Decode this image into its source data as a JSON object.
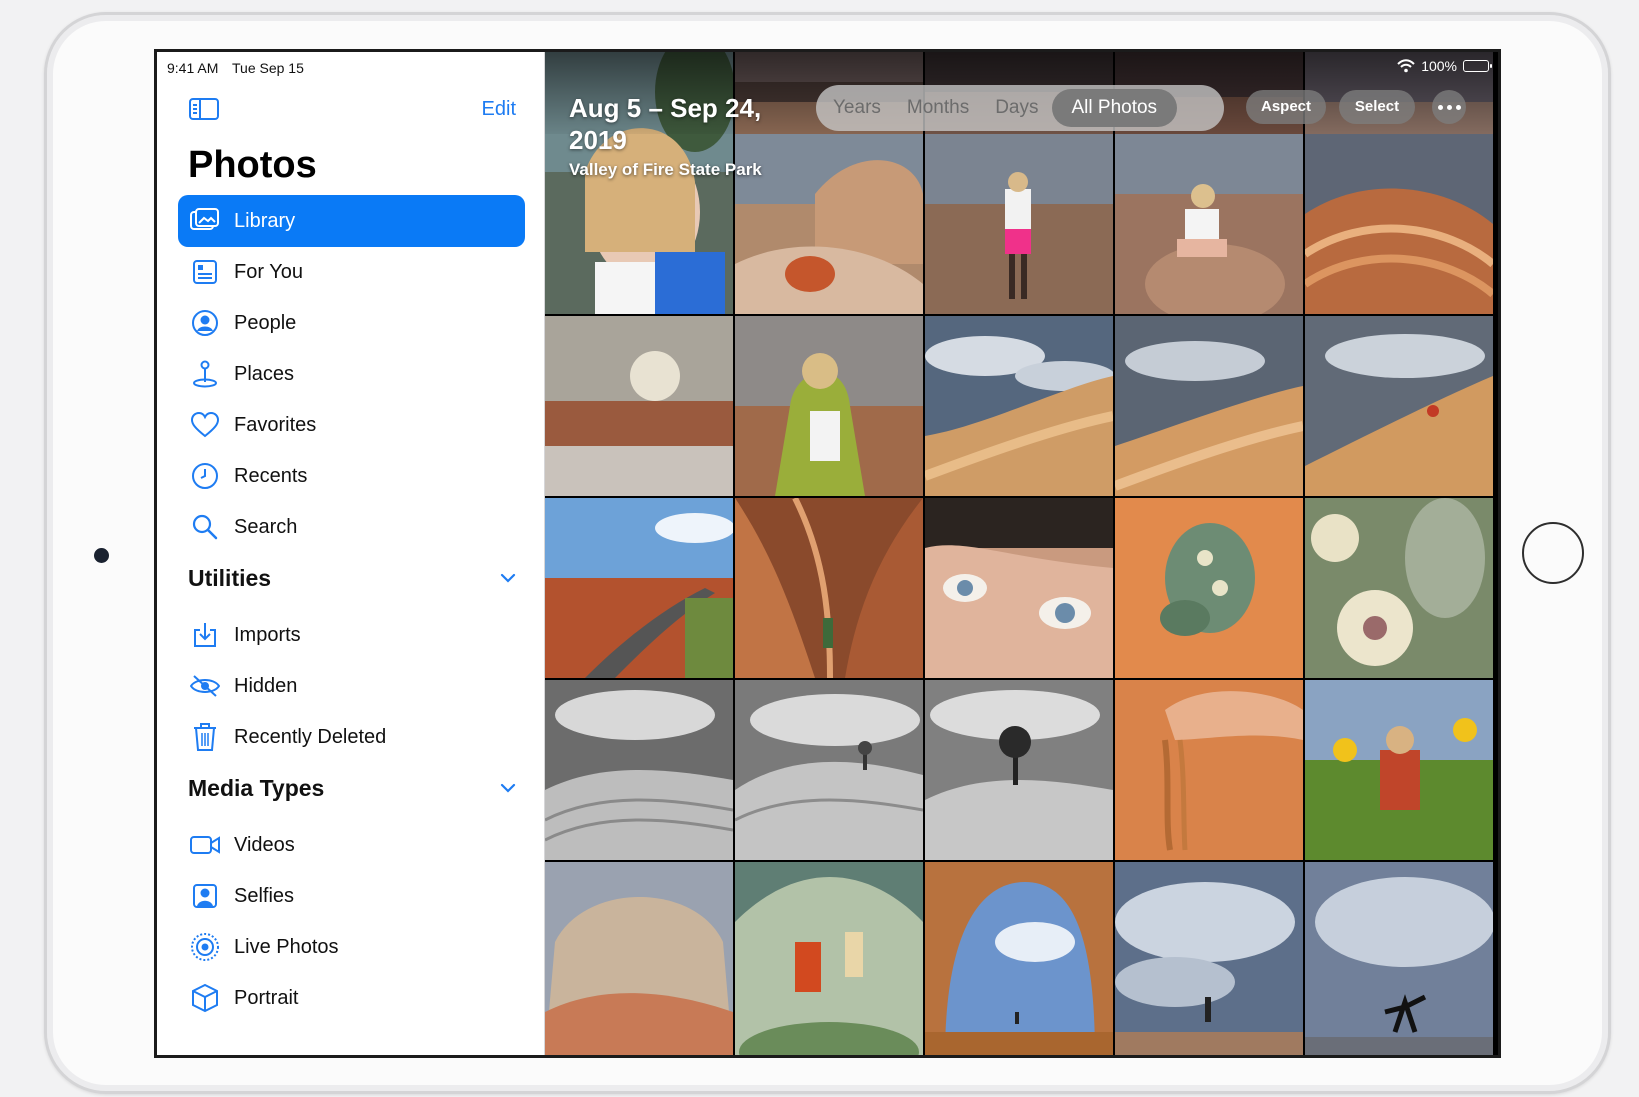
{
  "status_bar": {
    "time": "9:41 AM",
    "date": "Tue Sep 15",
    "battery": "100%"
  },
  "sidebar": {
    "edit_label": "Edit",
    "title": "Photos",
    "items": [
      {
        "label": "Library",
        "icon": "library-icon"
      },
      {
        "label": "For You",
        "icon": "for-you-icon"
      },
      {
        "label": "People",
        "icon": "people-icon"
      },
      {
        "label": "Places",
        "icon": "places-icon"
      },
      {
        "label": "Favorites",
        "icon": "heart-icon"
      },
      {
        "label": "Recents",
        "icon": "clock-icon"
      },
      {
        "label": "Search",
        "icon": "search-icon"
      }
    ],
    "utilities": {
      "title": "Utilities",
      "items": [
        {
          "label": "Imports",
          "icon": "import-icon"
        },
        {
          "label": "Hidden",
          "icon": "hidden-eye-icon"
        },
        {
          "label": "Recently Deleted",
          "icon": "trash-icon"
        }
      ]
    },
    "media_types": {
      "title": "Media Types",
      "items": [
        {
          "label": "Videos",
          "icon": "video-camera-icon"
        },
        {
          "label": "Selfies",
          "icon": "selfie-icon"
        },
        {
          "label": "Live Photos",
          "icon": "live-photo-icon"
        },
        {
          "label": "Portrait",
          "icon": "cube-icon"
        }
      ]
    }
  },
  "library": {
    "date_range": "Aug 5 – Sep 24, 2019",
    "location": "Valley of Fire State Park",
    "segments": [
      "Years",
      "Months",
      "Days",
      "All Photos"
    ],
    "active_segment": "All Photos",
    "aspect_label": "Aspect",
    "select_label": "Select"
  },
  "colors": {
    "accent": "#0a7af6",
    "sidebar_bg": "#ffffff",
    "grid_bg": "#000000"
  }
}
